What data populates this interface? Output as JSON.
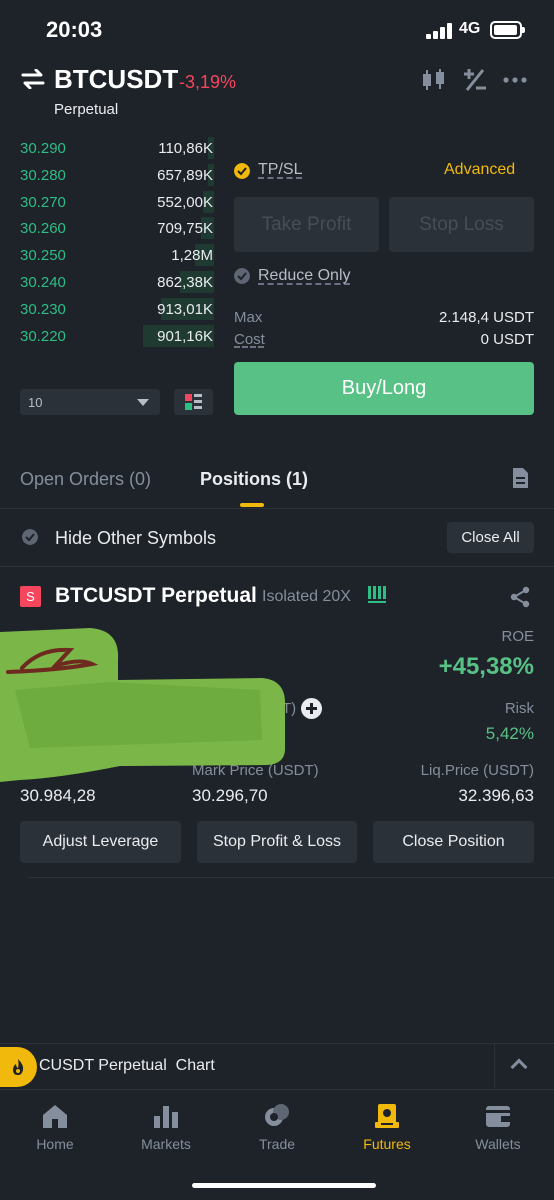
{
  "status_bar": {
    "time": "20:03",
    "network": "4G"
  },
  "header": {
    "symbol": "BTCUSDT",
    "change": "-3,19%",
    "contract_type": "Perpetual",
    "icons": [
      "candlestick-icon",
      "calculator-icon",
      "more-icon"
    ]
  },
  "order_book": {
    "rows": [
      {
        "price": "30.290",
        "qty": "110,86K",
        "depth": 0.03
      },
      {
        "price": "30.280",
        "qty": "657,89K",
        "depth": 0.03
      },
      {
        "price": "30.270",
        "qty": "552,00K",
        "depth": 0.05
      },
      {
        "price": "30.260",
        "qty": "709,75K",
        "depth": 0.06
      },
      {
        "price": "30.250",
        "qty": "1,28M",
        "depth": 0.09
      },
      {
        "price": "30.240",
        "qty": "862,38K",
        "depth": 0.16
      },
      {
        "price": "30.230",
        "qty": "913,01K",
        "depth": 0.25
      },
      {
        "price": "30.220",
        "qty": "901,16K",
        "depth": 0.33
      }
    ],
    "depth_value": "10"
  },
  "order_panel": {
    "tpsl_label": "TP/SL",
    "advanced_label": "Advanced",
    "take_profit": "Take Profit",
    "stop_loss": "Stop Loss",
    "reduce_only": "Reduce Only",
    "max_label": "Max",
    "max_value": "2.148,4 USDT",
    "cost_label": "Cost",
    "cost_value": "0 USDT",
    "buy_label": "Buy/Long"
  },
  "tabs": {
    "open_orders": "Open Orders (0)",
    "positions": "Positions (1)"
  },
  "filter": {
    "hide_other": "Hide Other Symbols",
    "close_all": "Close All"
  },
  "position": {
    "side": "S",
    "symbol": "BTCUSDT Perpetual",
    "mode": "Isolated 20X",
    "roe_label": "ROE",
    "roe": "+45,38%",
    "margin_label_fragment": "T)",
    "risk_label": "Risk",
    "risk": "5,42%",
    "mark_label": "Mark Price (USDT)",
    "liq_label": "Liq.Price (USDT)",
    "entry_price": "30.984,28",
    "mark_price": "30.296,70",
    "liq_price": "32.396,63",
    "btn_leverage": "Adjust Leverage",
    "btn_tpsl": "Stop Profit & Loss",
    "btn_close": "Close Position"
  },
  "chart_bar": {
    "label": "CUSDT Perpetual  Chart"
  },
  "nav": {
    "items": [
      {
        "label": "Home",
        "icon": "home-icon"
      },
      {
        "label": "Markets",
        "icon": "markets-icon"
      },
      {
        "label": "Trade",
        "icon": "trade-icon"
      },
      {
        "label": "Futures",
        "icon": "futures-icon"
      },
      {
        "label": "Wallets",
        "icon": "wallets-icon"
      }
    ],
    "active": "Futures"
  },
  "colors": {
    "accent": "#f0b90b",
    "buy": "#58c185",
    "sell": "#f6465d",
    "bg": "#1e2329"
  }
}
